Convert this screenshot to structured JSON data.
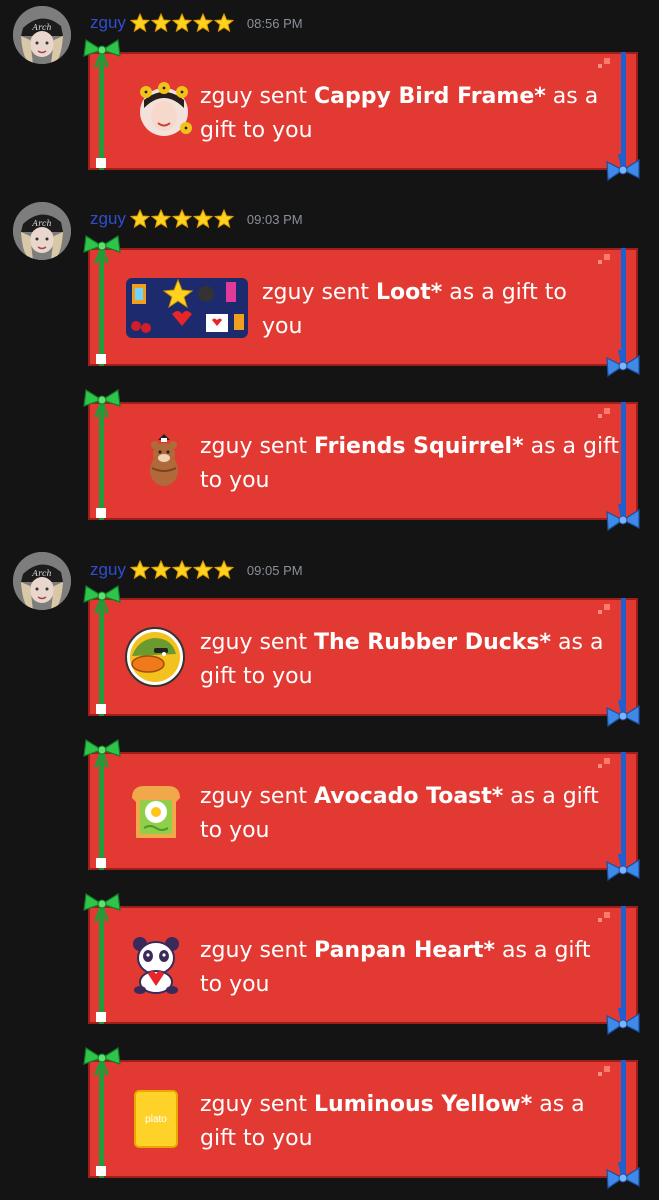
{
  "groups": [
    {
      "username": "zguy",
      "time": "08:56 PM"
    },
    {
      "username": "zguy",
      "time": "09:03 PM"
    },
    {
      "username": "zguy",
      "time": "09:05 PM"
    }
  ],
  "gifts": [
    {
      "pre": "zguy sent ",
      "item": "Cappy Bird Frame*",
      "post_a": " as a",
      "post_b": "gift to you",
      "icon": "cappy-bird-frame-icon"
    },
    {
      "pre": "zguy sent ",
      "item": "Loot*",
      "post_a": " as a gift to",
      "post_b": "you",
      "icon": "loot-icon"
    },
    {
      "pre": "zguy sent ",
      "item": "Friends Squirrel*",
      "post_a": " as a gift",
      "post_b": "to you",
      "icon": "squirrel-icon"
    },
    {
      "pre": "zguy sent ",
      "item": "The Rubber Ducks*",
      "post_a": " as a",
      "post_b": "gift to you",
      "icon": "rubber-duck-icon"
    },
    {
      "pre": "zguy sent ",
      "item": "Avocado Toast*",
      "post_a": " as a gift",
      "post_b": "to you",
      "icon": "avocado-toast-icon"
    },
    {
      "pre": "zguy sent ",
      "item": "Panpan Heart*",
      "post_a": " as a gift",
      "post_b": "to you",
      "icon": "panda-heart-icon"
    },
    {
      "pre": "zguy sent ",
      "item": "Luminous Yellow*",
      "post_a": " as a",
      "post_b": "gift to you",
      "icon": "luminous-yellow-card-icon"
    }
  ],
  "plato_label": "plato",
  "colors": {
    "card": "#e23a32",
    "username": "#2f4fd0",
    "ribbon_green": "#1f9d3a",
    "ribbon_blue": "#1f5fcf",
    "star": "#ffd21f"
  }
}
